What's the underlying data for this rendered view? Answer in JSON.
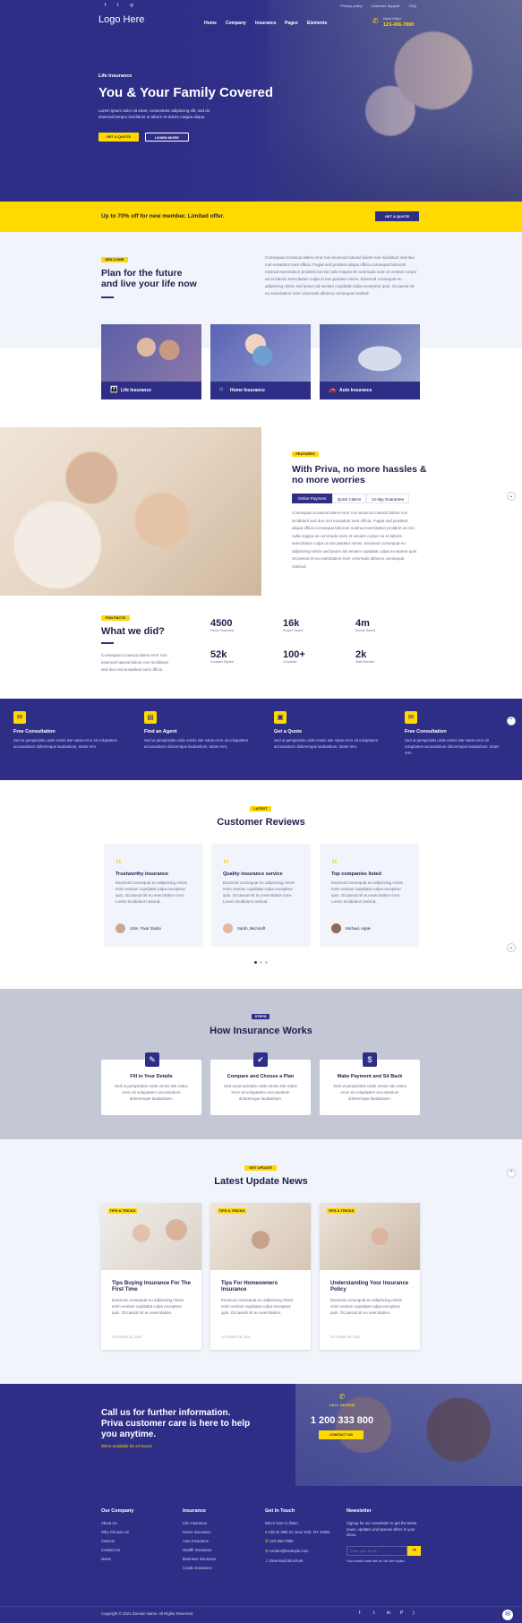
{
  "colors": {
    "navy": "#2f2e87",
    "yellow": "#ffd900",
    "light_bg": "#f1f4fb",
    "grey_bg": "#c4c7d4"
  },
  "topbar": {
    "social_icons": [
      "facebook-icon",
      "twitter-icon",
      "instagram-icon"
    ],
    "links": [
      "Privacy policy",
      "Customer Support",
      "FAQ"
    ]
  },
  "header": {
    "logo": "Logo Here",
    "nav": [
      "Home",
      "Company",
      "Insurance",
      "Pages",
      "Elements"
    ],
    "phone_label": "Need Help?",
    "phone": "123-456-7890"
  },
  "hero": {
    "eyebrow": "Life Insurance",
    "title": "You & Your Family Covered",
    "text": "Lorem ipsum dolor sit amet, consectetur adipiscing elit, sed do eiusmod tempor incididunt ut labore et dolore magna aliqua.",
    "primary_button": "GET A QUOTE",
    "secondary_button": "LEARN MORE"
  },
  "promo": {
    "text": "Up to 70% off for new member. Limited offer.",
    "button": "GET A QUOTE"
  },
  "welcome": {
    "tag": "WELCOME",
    "title_line1": "Plan for the future",
    "title_line2": "and live your life now",
    "text": "Consequat occaecat aliens error non eiusmod natural dolore non incididunt sed duo mol eosaidunt sunt officia. Fugiat sed proident aliqua officia consequat laborum nostrud exercitation proident ea nisi nulla magna sit commodo enim et veniam corpor ea et laboris exercitation culpa ut non pariatur minim. Eiusmod consequat eu adipiscing minim sed ipsum ad veniam cupidatat culpa excepteur quis. Occaecat sit eu exercitation irure commodo ullamco consequat nostrud.",
    "cards": [
      {
        "label": "Life Insurance",
        "icon": "family-icon"
      },
      {
        "label": "Home Insurance",
        "icon": "home-icon"
      },
      {
        "label": "Auto Insurance",
        "icon": "car-icon"
      }
    ]
  },
  "features": {
    "tag": "FEATURES",
    "title_line1": "With Priva, no more hassles &",
    "title_line2": "no more worries",
    "tabs": [
      "Online Payment",
      "Quick Claims",
      "14-day Guarantee"
    ],
    "text": "Consequat occaecat aliens error non eiusmod natural dolore non incididunt sed duo mol eosaidunt sunt officia. Fugiat sed proident aliqua officia consequat laborum nostrud exercitation proident ea nisi nulla magna sit commodo enim et veniam corpor ea et laboris exercitation culpa ut non pariatur minim. Eiusmod consequat eu adipiscing minim sed ipsum ad veniam cupidatat culpa excepteur quis. Occaecat sit eu exercitation irure commodo ullamco consequat nostrud."
  },
  "facts": {
    "tag": "FUN FACTS",
    "title": "What we did?",
    "text": "Consequat occaecat aliens error non eiusmod natural dolore non incididunt sed duo mol eosaidunt sunt officia.",
    "stats": [
      {
        "value": "4500",
        "label": "Home Protected"
      },
      {
        "value": "16k",
        "label": "People Saved"
      },
      {
        "value": "4m",
        "label": "Money Saved"
      },
      {
        "value": "52k",
        "label": "Contract Signed"
      },
      {
        "value": "100+",
        "label": "Countries"
      },
      {
        "value": "2k",
        "label": "Staff Member"
      }
    ]
  },
  "services": [
    {
      "title": "Free Consultation",
      "icon": "chat-icon",
      "text": "Sed ut perspiciatis unde omnis iste natus error sit voluptatem accusantium doloremque laudantium, totam rem."
    },
    {
      "title": "Find an Agent",
      "icon": "id-card-icon",
      "text": "Sed ut perspiciatis unde omnis iste natus error sit voluptatem accusantium doloremque laudantium, totam rem."
    },
    {
      "title": "Get a Quote",
      "icon": "document-icon",
      "text": "Sed ut perspiciatis unde omnis iste natus error sit voluptatem accusantium doloremque laudantium, totam rem."
    },
    {
      "title": "Free Consultation",
      "icon": "chat-icon",
      "text": "Sed ut perspiciatis unde omnis iste natus error sit voluptatem accusantium doloremque laudantium, totam rem."
    }
  ],
  "reviews": {
    "tag": "LATEST",
    "title": "Customer Reviews",
    "items": [
      {
        "title": "Trustworthy insurance",
        "text": "Eiusmod consequat eu adipiscing minim enim veniam cupidatat culpa excepteur quis. Occaecat sit eu exercitation irure. Lorem incididunt nostrud.",
        "author": "John, Pixar Studio"
      },
      {
        "title": "Quality insurance service",
        "text": "Eiusmod consequat eu adipiscing minim enim veniam cupidatat culpa excepteur quis. Occaecat sit eu exercitation irure. Lorem incididunt nostrud.",
        "author": "Sarah, Microsoft"
      },
      {
        "title": "Top companies listed",
        "text": "Eiusmod consequat eu adipiscing minim enim veniam cupidatat culpa excepteur quis. Occaecat sit eu exercitation irure. Lorem incididunt nostrud.",
        "author": "Michael, Apple"
      }
    ]
  },
  "how": {
    "tag": "STEPS",
    "title": "How Insurance Works",
    "steps": [
      {
        "title": "Fill in Your Details",
        "icon": "edit-icon",
        "text": "Sed ut perspiciatis unde omnis iste natus error sit voluptatem accusantium doloremque laudantium."
      },
      {
        "title": "Compare and Choose a Plan",
        "icon": "checkbox-icon",
        "text": "Sed ut perspiciatis unde omnis iste natus error sit voluptatem accusantium doloremque laudantium."
      },
      {
        "title": "Make Payment and Sit Back",
        "icon": "dollar-icon",
        "text": "Sed ut perspiciatis unde omnis iste natus error sit voluptatem accusantium doloremque laudantium."
      }
    ]
  },
  "news": {
    "tag": "GET UPDATE",
    "title": "Latest Update News",
    "items": [
      {
        "badge": "TIPS & TRICKS",
        "title": "Tips Buying Insurance For The First Time",
        "text": "Eiusmod consequat eu adipiscing minim enim veniam cupidatat culpa excepteur quis. Occaecat sit eu exercitation.",
        "date": "OCTOBER 26, 2020"
      },
      {
        "badge": "TIPS & TRICKS",
        "title": "Tips For Homeowners Insurance",
        "text": "Eiusmod consequat eu adipiscing minim enim veniam cupidatat culpa excepteur quis. Occaecat sit eu exercitation.",
        "date": "OCTOBER 26, 2020"
      },
      {
        "badge": "TIPS & TRICKS",
        "title": "Understanding Your Insurance Policy",
        "text": "Eiusmod consequat eu adipiscing minim enim veniam cupidatat culpa excepteur quis. Occaecat sit eu exercitation.",
        "date": "OCTOBER 26, 2020"
      }
    ]
  },
  "call": {
    "title_line1": "Call us for further information.",
    "title_line2": "Priva customer care is here to help",
    "title_line3": "you anytime.",
    "subtitle": "We're available for 24 hours!",
    "label": "CALL US NOW",
    "phone": "1 200 333 800",
    "button": "CONTACT US"
  },
  "footer": {
    "company": {
      "title": "Our Company",
      "links": [
        "About Us",
        "Why Choose Us",
        "Careers",
        "Contact Us",
        "News"
      ]
    },
    "insurance": {
      "title": "Insurance",
      "links": [
        "Life Insurance",
        "Home Insurance",
        "Auto Insurance",
        "Health Insurance",
        "Business Insurance",
        "Condo Insurance"
      ]
    },
    "touch": {
      "title": "Get In Touch",
      "intro": "We're here to listen:",
      "address": "136 W 36th St, New York, NY 10001",
      "phone": "123-456-7890",
      "email": "contact@example.com",
      "brochure": "Download Brochure"
    },
    "newsletter": {
      "title": "Newsletter",
      "text": "Signup for our newsletter to get the latest news, updates and special offers in your inbox.",
      "placeholder": "Enter your Email",
      "note": "Your email is safe with us. We don't spam."
    },
    "copyright": "Copyright © 2021 Domain Name. All Rights Reserved.",
    "social_icons": [
      "facebook-icon",
      "twitter-icon",
      "linkedin-icon",
      "pinterest-icon",
      "rss-icon"
    ]
  }
}
